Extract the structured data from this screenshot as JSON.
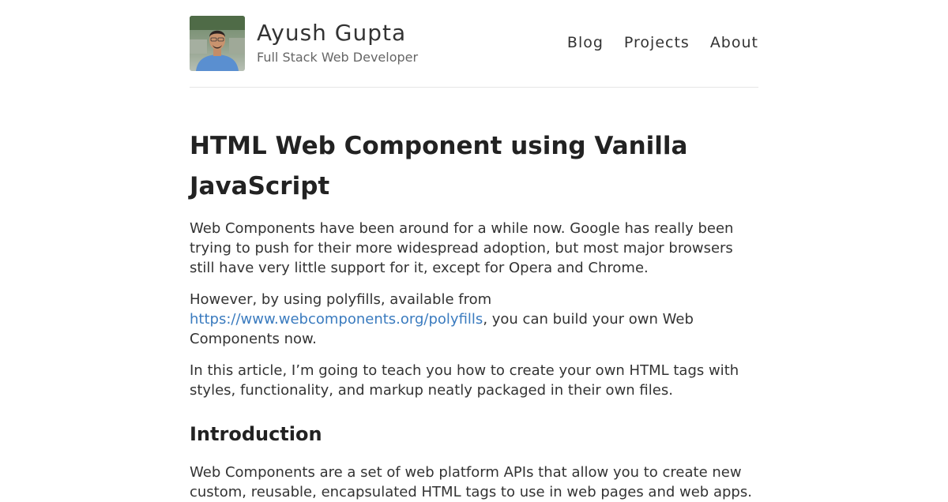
{
  "site": {
    "name": "Ayush Gupta",
    "tagline": "Full Stack Web Developer"
  },
  "nav": {
    "items": [
      "Blog",
      "Projects",
      "About"
    ]
  },
  "post": {
    "title": "HTML Web Component using Vanilla JavaScript",
    "p1": "Web Components have been around for a while now. Google has really been trying to push for their more widespread adoption, but most major browsers still have very little support for it, except for Opera and Chrome.",
    "p2_before": "However, by using polyfills, available from ",
    "p2_link": "https://www.webcomponents.org/polyfills",
    "p2_after": ", you can build your own Web Components now.",
    "p3": "In this article, I’m going to teach you how to create your own HTML tags with styles, functionality, and markup neatly packaged in their own files.",
    "h_intro": "Introduction",
    "p4": "Web Components are a set of web platform APIs that allow you to create new custom, reusable, encapsulated HTML tags to use in web pages and web apps."
  },
  "colors": {
    "link": "#3a7bbf",
    "text": "#333333",
    "heading": "#222222"
  }
}
